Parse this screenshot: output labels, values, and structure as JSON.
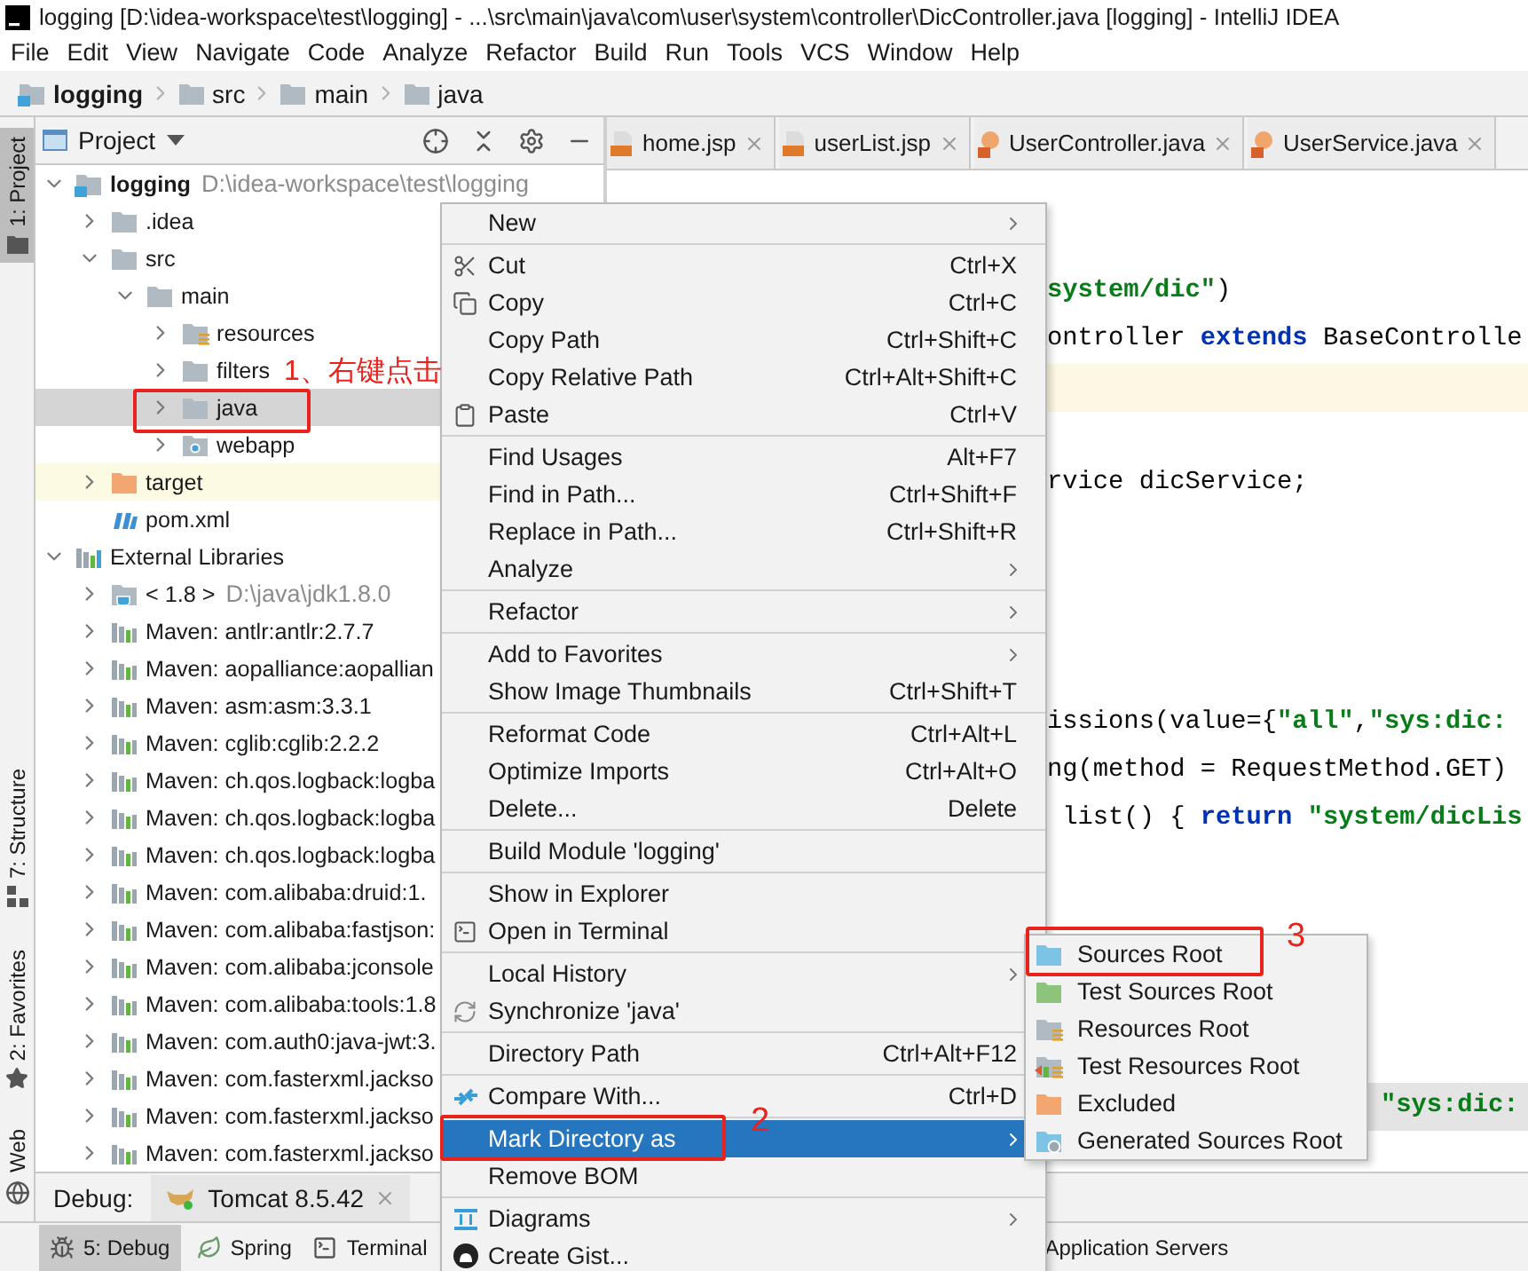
{
  "window": {
    "title": "logging [D:\\idea-workspace\\test\\logging] - ...\\src\\main\\java\\com\\user\\system\\controller\\DicController.java [logging] - IntelliJ IDEA"
  },
  "menu_bar": [
    "File",
    "Edit",
    "View",
    "Navigate",
    "Code",
    "Analyze",
    "Refactor",
    "Build",
    "Run",
    "Tools",
    "VCS",
    "Window",
    "Help"
  ],
  "breadcrumb": [
    {
      "label": "logging",
      "kind": "module"
    },
    {
      "label": "src",
      "kind": "folder"
    },
    {
      "label": "main",
      "kind": "folder"
    },
    {
      "label": "java",
      "kind": "folder"
    }
  ],
  "left_stripe": [
    {
      "label": "1: Project",
      "selected": true
    },
    {
      "label": "7: Structure",
      "selected": false
    },
    {
      "label": "2: Favorites",
      "selected": false
    },
    {
      "label": "Web",
      "selected": false
    }
  ],
  "project_panel": {
    "title": "Project",
    "tree": [
      {
        "label": "logging",
        "detail": "D:\\idea-workspace\\test\\logging",
        "kind": "module",
        "expanded": true,
        "selected": false,
        "hovered": false,
        "children": [
          {
            "label": ".idea",
            "kind": "folder",
            "expanded": false,
            "selected": false,
            "hovered": false
          },
          {
            "label": "src",
            "kind": "folder",
            "expanded": true,
            "selected": false,
            "hovered": false,
            "children": [
              {
                "label": "main",
                "kind": "folder",
                "expanded": true,
                "selected": false,
                "hovered": false,
                "children": [
                  {
                    "label": "resources",
                    "kind": "resources",
                    "expanded": false,
                    "selected": false,
                    "hovered": false
                  },
                  {
                    "label": "filters",
                    "kind": "folder",
                    "expanded": false,
                    "selected": false,
                    "hovered": false
                  },
                  {
                    "label": "java",
                    "kind": "folder",
                    "expanded": false,
                    "selected": true,
                    "hovered": false
                  },
                  {
                    "label": "webapp",
                    "kind": "web",
                    "expanded": false,
                    "selected": false,
                    "hovered": false
                  }
                ]
              }
            ]
          },
          {
            "label": "target",
            "kind": "excluded",
            "expanded": false,
            "selected": false,
            "hovered": true
          },
          {
            "label": "pom.xml",
            "kind": "pom",
            "selected": false,
            "hovered": false
          }
        ]
      },
      {
        "label": "External Libraries",
        "kind": "libraries",
        "expanded": true,
        "selected": false,
        "hovered": false,
        "children": [
          {
            "label": "< 1.8 >",
            "detail": "D:\\java\\jdk1.8.0",
            "kind": "jdk",
            "expanded": false,
            "selected": false,
            "hovered": false
          },
          {
            "label": "Maven: antlr:antlr:2.7.7",
            "kind": "library",
            "expanded": false,
            "selected": false,
            "hovered": false
          },
          {
            "label": "Maven: aopalliance:aopallian",
            "kind": "library",
            "expanded": false,
            "selected": false,
            "hovered": false
          },
          {
            "label": "Maven: asm:asm:3.3.1",
            "kind": "library",
            "expanded": false,
            "selected": false,
            "hovered": false
          },
          {
            "label": "Maven: cglib:cglib:2.2.2",
            "kind": "library",
            "expanded": false,
            "selected": false,
            "hovered": false
          },
          {
            "label": "Maven: ch.qos.logback:logba",
            "kind": "library",
            "expanded": false,
            "selected": false,
            "hovered": false
          },
          {
            "label": "Maven: ch.qos.logback:logba",
            "kind": "library",
            "expanded": false,
            "selected": false,
            "hovered": false
          },
          {
            "label": "Maven: ch.qos.logback:logba",
            "kind": "library",
            "expanded": false,
            "selected": false,
            "hovered": false
          },
          {
            "label": "Maven: com.alibaba:druid:1.",
            "kind": "library",
            "expanded": false,
            "selected": false,
            "hovered": false
          },
          {
            "label": "Maven: com.alibaba:fastjson:",
            "kind": "library",
            "expanded": false,
            "selected": false,
            "hovered": false
          },
          {
            "label": "Maven: com.alibaba:jconsole",
            "kind": "library",
            "expanded": false,
            "selected": false,
            "hovered": false
          },
          {
            "label": "Maven: com.alibaba:tools:1.8",
            "kind": "library",
            "expanded": false,
            "selected": false,
            "hovered": false
          },
          {
            "label": "Maven: com.auth0:java-jwt:3.",
            "kind": "library",
            "expanded": false,
            "selected": false,
            "hovered": false
          },
          {
            "label": "Maven: com.fasterxml.jackso",
            "kind": "library",
            "expanded": false,
            "selected": false,
            "hovered": false
          },
          {
            "label": "Maven: com.fasterxml.jackso",
            "kind": "library",
            "expanded": false,
            "selected": false,
            "hovered": false
          },
          {
            "label": "Maven: com.fasterxml.jackso",
            "kind": "library",
            "expanded": false,
            "selected": false,
            "hovered": false
          }
        ]
      }
    ]
  },
  "editor": {
    "tabs": [
      {
        "label": "home.jsp",
        "kind": "jsp",
        "selected": false
      },
      {
        "label": "userList.jsp",
        "kind": "jsp",
        "selected": false
      },
      {
        "label": "UserController.java",
        "kind": "java",
        "selected": false
      },
      {
        "label": "UserService.java",
        "kind": "java",
        "selected": false
      }
    ],
    "lines": [
      {
        "segments": [
          {
            "text": "system/dic\"",
            "kind": "string"
          },
          {
            "text": ")",
            "kind": "plain"
          }
        ],
        "current": false,
        "shaded": false
      },
      {
        "segments": [
          {
            "text": "ontroller ",
            "kind": "plain"
          },
          {
            "text": "extends",
            "kind": "keyword"
          },
          {
            "text": " BaseControlle",
            "kind": "plain"
          }
        ],
        "current": false,
        "shaded": false
      },
      {
        "current": true,
        "shaded": false
      },
      {
        "segments": [
          {
            "text": "rvice dicService;",
            "kind": "plain"
          }
        ],
        "current": false,
        "shaded": false
      },
      {
        "segments": [
          {
            "text": "issions(value={",
            "kind": "plain"
          },
          {
            "text": "\"all\"",
            "kind": "string"
          },
          {
            "text": ",",
            "kind": "plain"
          },
          {
            "text": "\"sys:dic:",
            "kind": "string"
          }
        ],
        "current": false,
        "shaded": false
      },
      {
        "segments": [
          {
            "text": "ng(method = RequestMethod.GET)",
            "kind": "plain"
          }
        ],
        "current": false,
        "shaded": false
      },
      {
        "segments": [
          {
            "text": " list() { ",
            "kind": "plain"
          },
          {
            "text": "return",
            "kind": "keyword"
          },
          {
            "text": " \"system/dicLis",
            "kind": "string"
          }
        ],
        "current": false,
        "shaded": false
      },
      {
        "segments": [
          {
            "text": "\"sys:dic:",
            "kind": "string"
          }
        ],
        "current": false,
        "shaded": true
      }
    ]
  },
  "debug_bar": {
    "label": "Debug:",
    "tabs": [
      {
        "label": "Tomcat 8.5.42",
        "selected": true
      }
    ]
  },
  "tool_stripe": [
    {
      "label": "5: Debug",
      "selected": true
    },
    {
      "label": "Spring",
      "selected": false
    },
    {
      "label": "Terminal",
      "selected": false
    },
    {
      "label": "Application Servers",
      "selected": false
    }
  ],
  "context_menu": {
    "items": [
      {
        "kind": "item",
        "label": "New",
        "submenu": true,
        "selected": false
      },
      {
        "kind": "separator"
      },
      {
        "kind": "item",
        "label": "Cut",
        "shortcut": "Ctrl+X",
        "submenu": false,
        "selected": false
      },
      {
        "kind": "item",
        "label": "Copy",
        "shortcut": "Ctrl+C",
        "submenu": false,
        "selected": false
      },
      {
        "kind": "item",
        "label": "Copy Path",
        "shortcut": "Ctrl+Shift+C",
        "submenu": false,
        "selected": false
      },
      {
        "kind": "item",
        "label": "Copy Relative Path",
        "shortcut": "Ctrl+Alt+Shift+C",
        "submenu": false,
        "selected": false
      },
      {
        "kind": "item",
        "label": "Paste",
        "shortcut": "Ctrl+V",
        "submenu": false,
        "selected": false
      },
      {
        "kind": "separator"
      },
      {
        "kind": "item",
        "label": "Find Usages",
        "shortcut": "Alt+F7",
        "submenu": false,
        "selected": false
      },
      {
        "kind": "item",
        "label": "Find in Path...",
        "shortcut": "Ctrl+Shift+F",
        "submenu": false,
        "selected": false
      },
      {
        "kind": "item",
        "label": "Replace in Path...",
        "shortcut": "Ctrl+Shift+R",
        "submenu": false,
        "selected": false
      },
      {
        "kind": "item",
        "label": "Analyze",
        "submenu": true,
        "selected": false
      },
      {
        "kind": "separator"
      },
      {
        "kind": "item",
        "label": "Refactor",
        "submenu": true,
        "selected": false
      },
      {
        "kind": "separator"
      },
      {
        "kind": "item",
        "label": "Add to Favorites",
        "submenu": true,
        "selected": false
      },
      {
        "kind": "item",
        "label": "Show Image Thumbnails",
        "shortcut": "Ctrl+Shift+T",
        "submenu": false,
        "selected": false
      },
      {
        "kind": "separator"
      },
      {
        "kind": "item",
        "label": "Reformat Code",
        "shortcut": "Ctrl+Alt+L",
        "submenu": false,
        "selected": false
      },
      {
        "kind": "item",
        "label": "Optimize Imports",
        "shortcut": "Ctrl+Alt+O",
        "submenu": false,
        "selected": false
      },
      {
        "kind": "item",
        "label": "Delete...",
        "shortcut": "Delete",
        "submenu": false,
        "selected": false
      },
      {
        "kind": "separator"
      },
      {
        "kind": "item",
        "label": "Build Module 'logging'",
        "submenu": false,
        "selected": false
      },
      {
        "kind": "separator"
      },
      {
        "kind": "item",
        "label": "Show in Explorer",
        "submenu": false,
        "selected": false
      },
      {
        "kind": "item",
        "label": "Open in Terminal",
        "submenu": false,
        "selected": false
      },
      {
        "kind": "separator"
      },
      {
        "kind": "item",
        "label": "Local History",
        "submenu": true,
        "selected": false
      },
      {
        "kind": "item",
        "label": "Synchronize 'java'",
        "submenu": false,
        "selected": false
      },
      {
        "kind": "separator"
      },
      {
        "kind": "item",
        "label": "Directory Path",
        "shortcut": "Ctrl+Alt+F12",
        "submenu": false,
        "selected": false
      },
      {
        "kind": "separator"
      },
      {
        "kind": "item",
        "label": "Compare With...",
        "shortcut": "Ctrl+D",
        "submenu": false,
        "selected": false
      },
      {
        "kind": "separator"
      },
      {
        "kind": "item",
        "label": "Mark Directory as",
        "submenu": true,
        "selected": true
      },
      {
        "kind": "item",
        "label": "Remove BOM",
        "submenu": false,
        "selected": false
      },
      {
        "kind": "separator"
      },
      {
        "kind": "item",
        "label": "Diagrams",
        "submenu": true,
        "selected": false
      },
      {
        "kind": "item",
        "label": "Create Gist...",
        "submenu": false,
        "selected": false
      }
    ]
  },
  "submenu": {
    "items": [
      {
        "label": "Sources Root",
        "kind": "sources"
      },
      {
        "label": "Test Sources Root",
        "kind": "test-sources"
      },
      {
        "label": "Resources Root",
        "kind": "resources"
      },
      {
        "label": "Test Resources Root",
        "kind": "test-resources"
      },
      {
        "label": "Excluded",
        "kind": "excluded"
      },
      {
        "label": "Generated Sources Root",
        "kind": "generated"
      }
    ]
  },
  "annotations": [
    {
      "text": "1、右键点击"
    },
    {
      "text": "2"
    },
    {
      "text": "3"
    }
  ]
}
